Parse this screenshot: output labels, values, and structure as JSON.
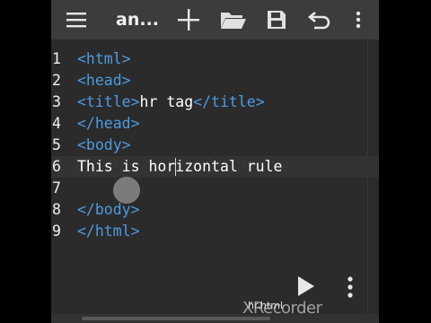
{
  "toolbar": {
    "title": "an..."
  },
  "icons": {
    "menu": "menu-icon",
    "add": "plus-icon",
    "open": "folder-open-icon",
    "save": "save-icon",
    "undo": "undo-icon",
    "more": "more-vertical-icon",
    "run": "play-icon"
  },
  "editor": {
    "lines": [
      {
        "num": "1",
        "parts": [
          [
            "tag",
            "<html>"
          ]
        ]
      },
      {
        "num": "2",
        "parts": [
          [
            "tag",
            "<head>"
          ]
        ]
      },
      {
        "num": "3",
        "parts": [
          [
            "tag",
            "<title>"
          ],
          [
            "txt",
            "hr tag"
          ],
          [
            "tag",
            "</title>"
          ]
        ]
      },
      {
        "num": "4",
        "parts": [
          [
            "tag",
            "</head>"
          ]
        ]
      },
      {
        "num": "5",
        "parts": [
          [
            "tag",
            "<body>"
          ]
        ]
      },
      {
        "num": "6",
        "parts": [
          [
            "txt",
            "This is horizontal rule"
          ]
        ]
      },
      {
        "num": "7",
        "parts": []
      },
      {
        "num": "8",
        "parts": [
          [
            "tag",
            "</body>"
          ]
        ]
      },
      {
        "num": "9",
        "parts": [
          [
            "tag",
            "</html>"
          ]
        ]
      }
    ],
    "active_line": 6
  },
  "footer": {
    "filename": "hr.html",
    "watermark": "XRecorder"
  },
  "colors": {
    "tag": "#4d9be0",
    "text": "#ffffff",
    "toolbar": "#3c3c3c",
    "editor_bg": "#2b2b2b"
  }
}
